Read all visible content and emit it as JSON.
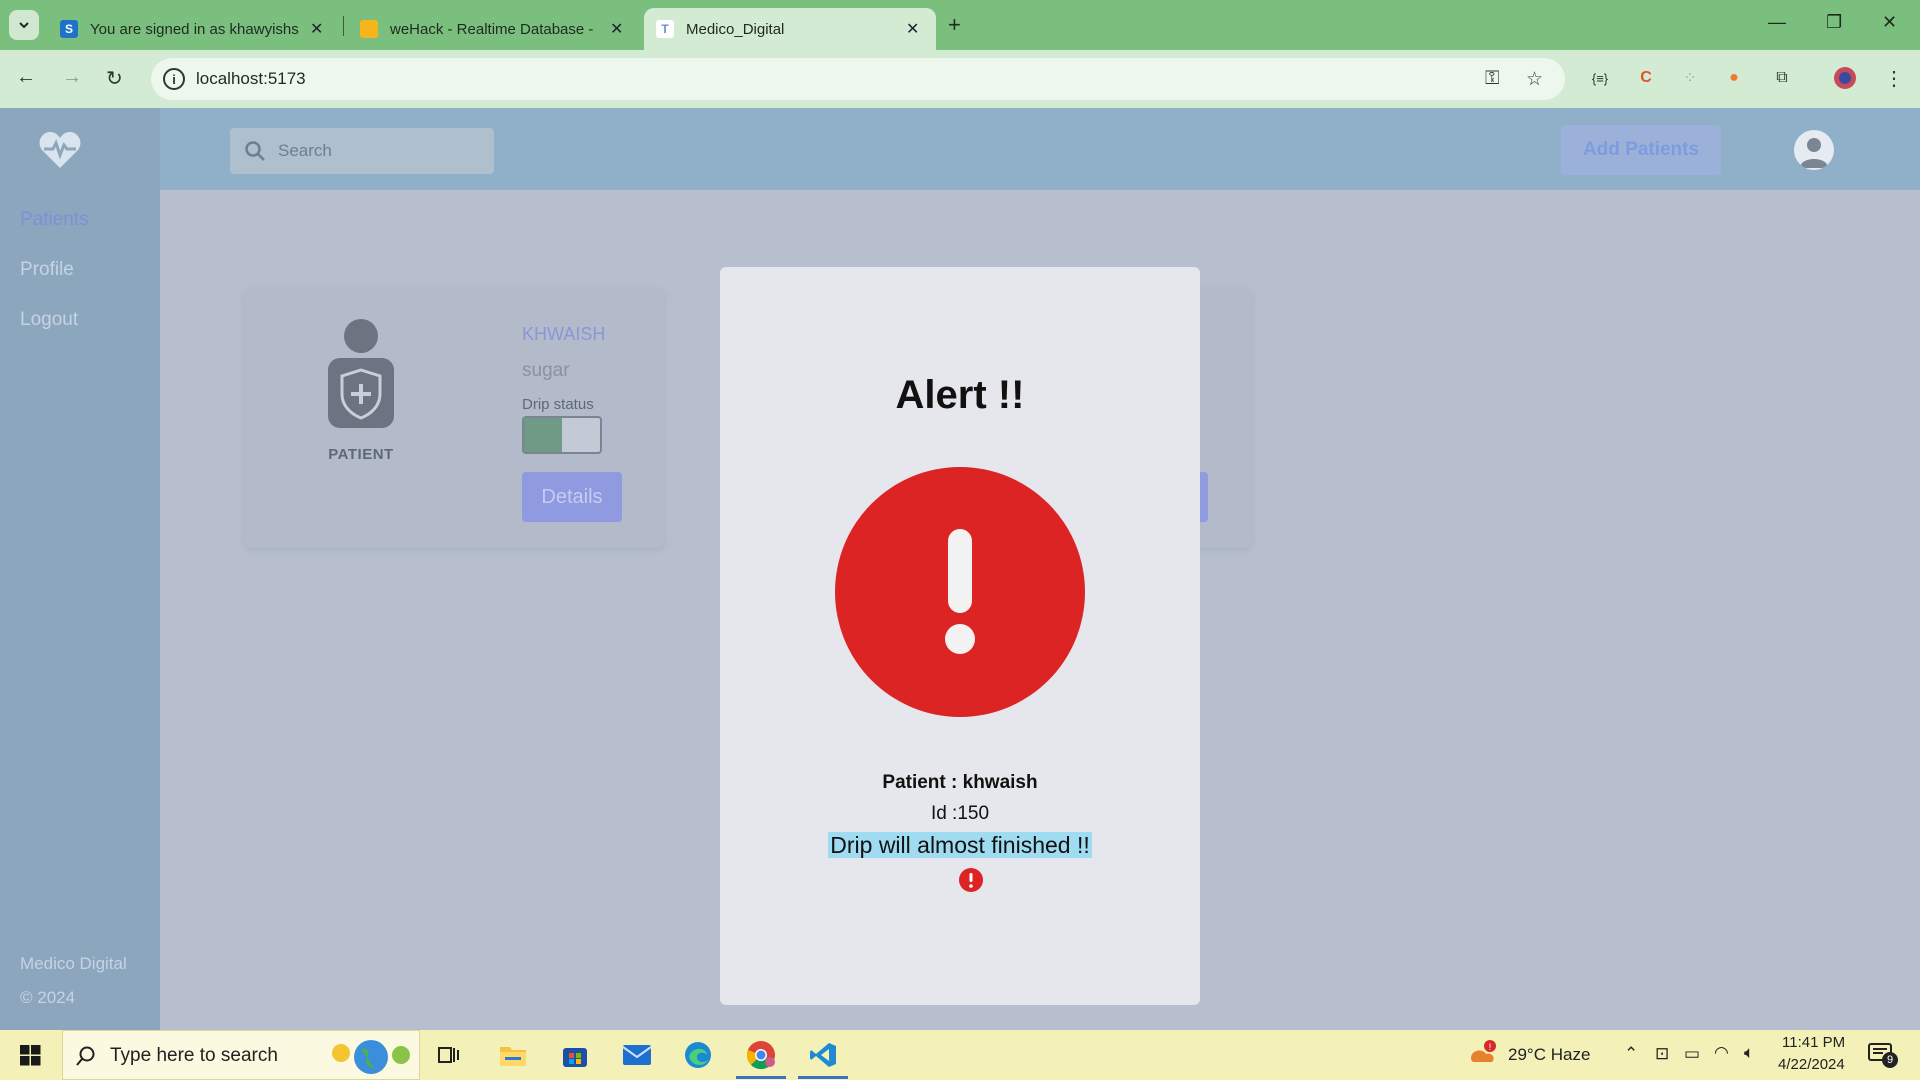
{
  "browser": {
    "tabs": [
      {
        "title": "You are signed in as khawyishs",
        "favicon": "S"
      },
      {
        "title": "weHack - Realtime Database -",
        "favicon": ""
      },
      {
        "title": "Medico_Digital",
        "favicon": "T"
      }
    ],
    "url": "localhost:5173"
  },
  "app": {
    "sidebar": {
      "items": [
        {
          "label": "Patients",
          "active": true
        },
        {
          "label": "Profile",
          "active": false
        },
        {
          "label": "Logout",
          "active": false
        }
      ],
      "footer_name": "Medico Digital",
      "footer_year": "© 2024"
    },
    "topbar": {
      "search_placeholder": "Search",
      "add_button": "Add Patients"
    },
    "patient_card": {
      "tag": "PATIENT",
      "name": "KHWAISH",
      "condition": "sugar",
      "drip_label": "Drip status",
      "drip_level": 0.5,
      "details_button": "Details"
    }
  },
  "modal": {
    "title": "Alert !!",
    "patient_line": "Patient : khwaish",
    "id_line": "Id :150",
    "message": "Drip will almost finished !!",
    "alert_color": "#dd2424"
  },
  "taskbar": {
    "search_text": "Type here to search",
    "weather": "29°C  Haze",
    "time": "11:41 PM",
    "date": "4/22/2024",
    "notifications": "9"
  }
}
